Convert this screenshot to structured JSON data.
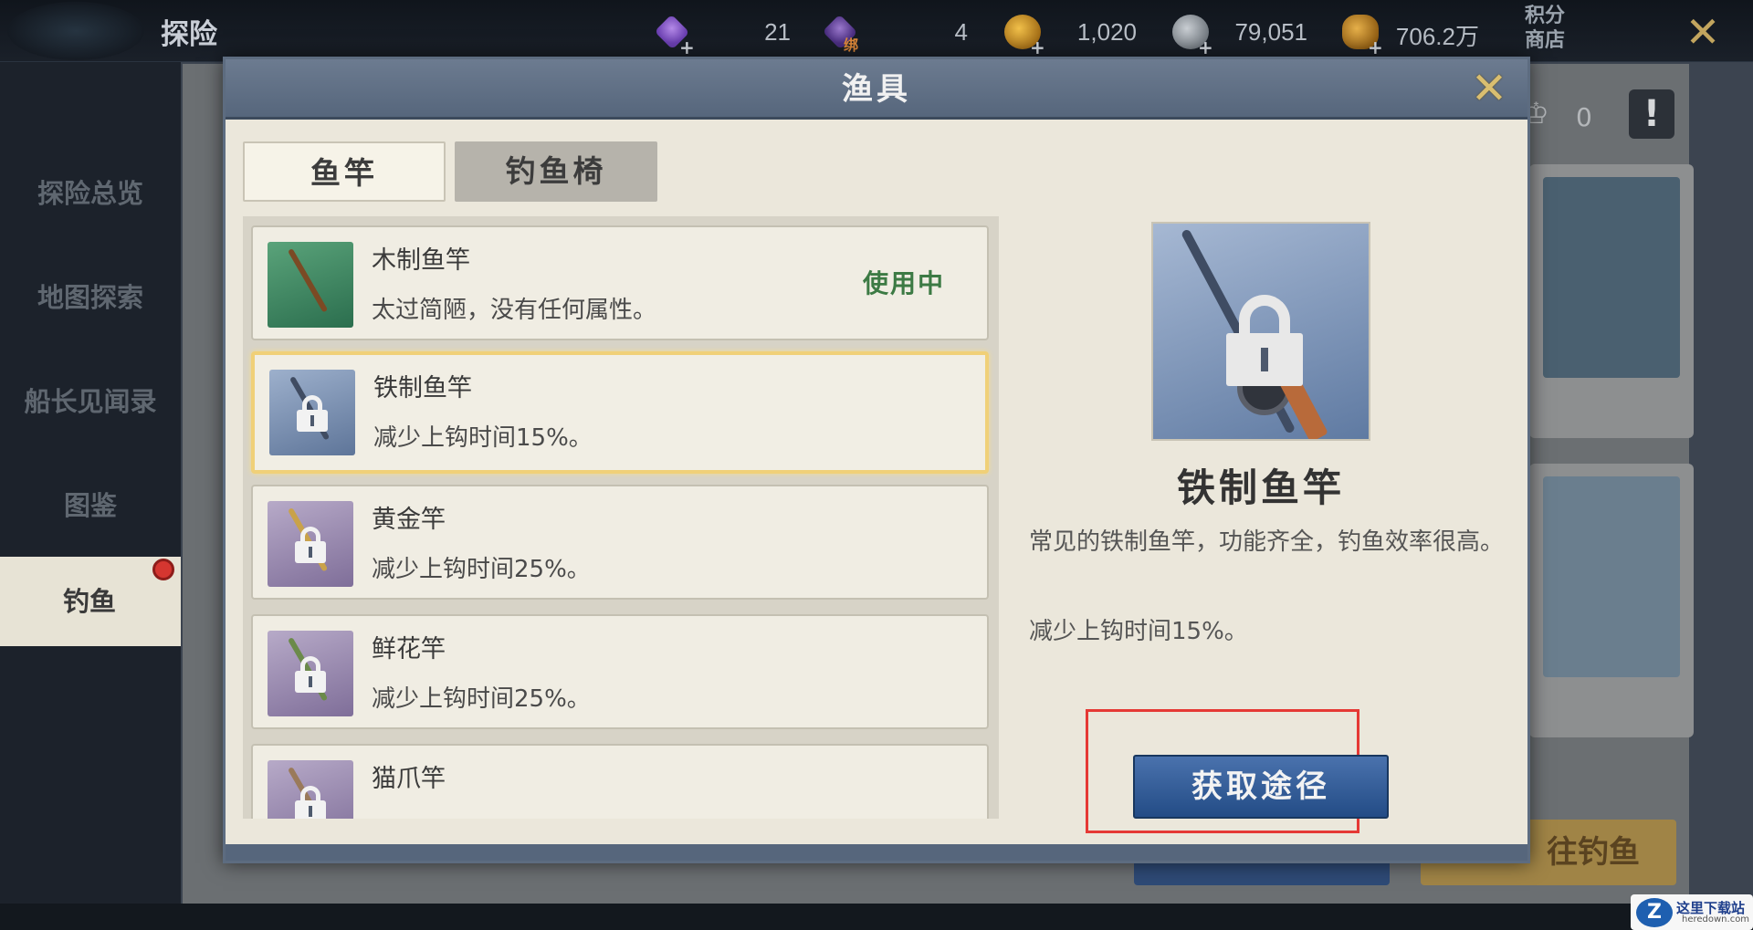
{
  "topbar": {
    "title": "探险",
    "currencies": [
      {
        "icon": "purple-gem-icon",
        "value": "21",
        "tag": ""
      },
      {
        "icon": "bound-gem-icon",
        "value": "4",
        "tag": "绑"
      },
      {
        "icon": "gold-coin-icon",
        "value": "1,020",
        "tag": ""
      },
      {
        "icon": "silver-coin-icon",
        "value": "79,051",
        "tag": ""
      },
      {
        "icon": "coin-stack-icon",
        "value": "706.2万",
        "tag": ""
      }
    ],
    "shop_label": "积分\n商店",
    "shop_line1": "积分",
    "shop_line2": "商店"
  },
  "sidebar": {
    "items": [
      {
        "label": "探险总览",
        "active": false
      },
      {
        "label": "地图探索",
        "active": false
      },
      {
        "label": "船长见闻录",
        "active": false
      },
      {
        "label": "图鉴",
        "active": false
      },
      {
        "label": "钓鱼",
        "active": true
      }
    ]
  },
  "background": {
    "crown_count": "0",
    "fish_button": "往钓鱼"
  },
  "modal": {
    "title": "渔具",
    "tabs": [
      {
        "label": "鱼竿",
        "selected": true
      },
      {
        "label": "钓鱼椅",
        "selected": false
      }
    ],
    "items": [
      {
        "name": "木制鱼竿",
        "desc": "太过简陋，没有任何属性。",
        "status": "使用中",
        "locked": false,
        "color": "green"
      },
      {
        "name": "铁制鱼竿",
        "desc": "减少上钩时间15%。",
        "status": "",
        "locked": true,
        "color": "blue",
        "selected": true
      },
      {
        "name": "黄金竿",
        "desc": "减少上钩时间25%。",
        "status": "",
        "locked": true,
        "color": "purple"
      },
      {
        "name": "鲜花竿",
        "desc": "减少上钩时间25%。",
        "status": "",
        "locked": true,
        "color": "purple"
      },
      {
        "name": "猫爪竿",
        "desc": "",
        "status": "",
        "locked": true,
        "color": "purple"
      }
    ],
    "detail": {
      "name": "铁制鱼竿",
      "desc": "常见的铁制鱼竿，功能齐全，钓鱼效率很高。",
      "effect": "减少上钩时间15%。",
      "button": "获取途径"
    }
  },
  "watermark": {
    "logo": "Z",
    "text": "这里下载站",
    "sub": "heredown.com"
  },
  "colors": {
    "accent_blue": "#234c86",
    "status_green": "#3c7a44",
    "highlight_red": "#e53935",
    "selection_gold": "#f0d078"
  }
}
